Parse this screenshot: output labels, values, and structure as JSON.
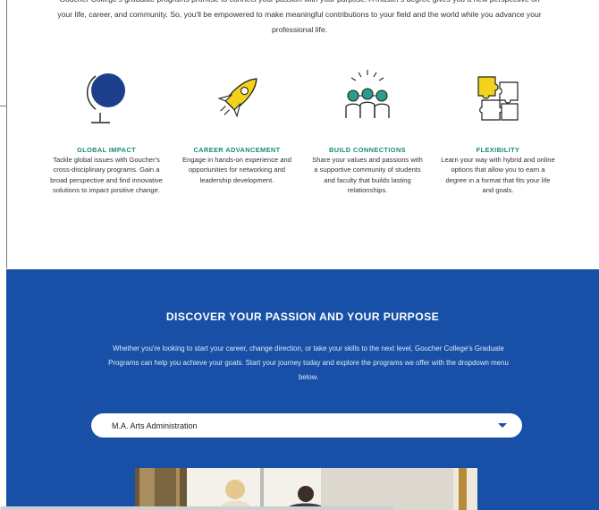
{
  "intro": {
    "text": "Goucher College's graduate programs promise to connect your passion with your purpose. A master's degree gives you a new perspective on your life, career, and community. So, you'll be empowered to make meaningful contributions to your field and the world while you advance your professional life."
  },
  "features": [
    {
      "icon": "globe-icon",
      "title": "GLOBAL IMPACT",
      "text": "Tackle global issues with Goucher's cross-disciplinary programs. Gain a broad perspective and find innovative solutions to impact positive change."
    },
    {
      "icon": "rocket-icon",
      "title": "CAREER ADVANCEMENT",
      "text": "Engage in hands-on experience and opportunities for networking and leadership development."
    },
    {
      "icon": "people-network-icon",
      "title": "BUILD CONNECTIONS",
      "text": "Share your values and passions with a supportive community of students and faculty that builds lasting relationships."
    },
    {
      "icon": "puzzle-icon",
      "title": "FLEXIBILITY",
      "text": "Learn your way with hybrid and online options that allow you to earn a degree in a format that fits your life and goals."
    }
  ],
  "discover": {
    "heading": "DISCOVER YOUR PASSION AND YOUR PURPOSE",
    "description": "Whether you're looking to start your career, change direction, or take your skills to the next level, Goucher College's Graduate Programs can help you achieve your goals. Start your journey today and explore the programs we offer with the dropdown menu below.",
    "select_value": "M.A. Arts Administration"
  },
  "colors": {
    "accent_teal": "#1a8a7a",
    "brand_blue": "#1750a6",
    "icon_yellow": "#f2d21b",
    "icon_navy": "#1c3f8c"
  }
}
